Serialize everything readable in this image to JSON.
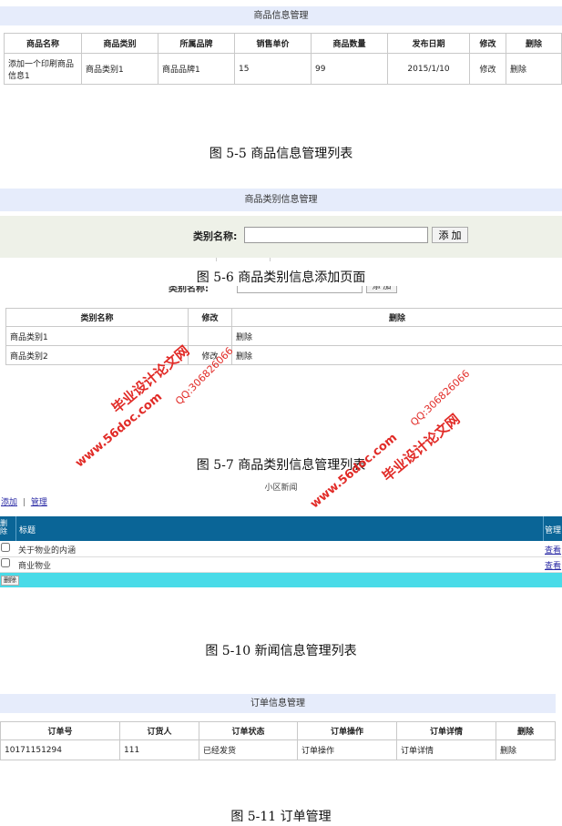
{
  "product": {
    "title": "商品信息管理",
    "headers": [
      "商品名称",
      "商品类别",
      "所属品牌",
      "销售单价",
      "商品数量",
      "发布日期",
      "修改",
      "删除"
    ],
    "row": [
      "添加一个印刷商品信息1",
      "商品类别1",
      "商品品牌1",
      "15",
      "99",
      "2015/1/10",
      "修改",
      "删除"
    ],
    "caption": "图 5-5 商品信息管理列表"
  },
  "category_add": {
    "title": "商品类别信息管理",
    "label": "类别名称:",
    "input_value": "",
    "button": "添 加",
    "caption": "图 5-6 商品类别信息添加页面"
  },
  "category_list": {
    "top_label": "类别名称:",
    "top_button": "添 加",
    "headers": [
      "类别名称",
      "修改",
      "删除"
    ],
    "rows": [
      [
        "商品类别1",
        "修改",
        "删除"
      ],
      [
        "商品类别2",
        "修改",
        "删除"
      ]
    ],
    "caption": "图 5-7 商品类别信息管理列表"
  },
  "news": {
    "title": "小区新闻",
    "links": [
      "添加",
      "管理"
    ],
    "separator": "|",
    "headers": [
      "删除",
      "标题",
      "管理"
    ],
    "rows": [
      {
        "title": "关于物业的内涵",
        "action": "查看"
      },
      {
        "title": "商业物业",
        "action": "查看"
      }
    ],
    "delete_button": "删除",
    "caption": "图 5-10 新闻信息管理列表"
  },
  "orders": {
    "title": "订单信息管理",
    "headers": [
      "订单号",
      "订货人",
      "订单状态",
      "订单操作",
      "订单详情",
      "删除"
    ],
    "row": [
      "10171151294",
      "111",
      "已经发货",
      "订单操作",
      "订单详情",
      "删除"
    ],
    "caption": "图 5-11 订单管理"
  },
  "watermarks": {
    "site_cn": "毕业设计论文网",
    "site_url": "www.56doc.com",
    "qq": "QQ:306826066",
    "color": "#e0201c"
  }
}
